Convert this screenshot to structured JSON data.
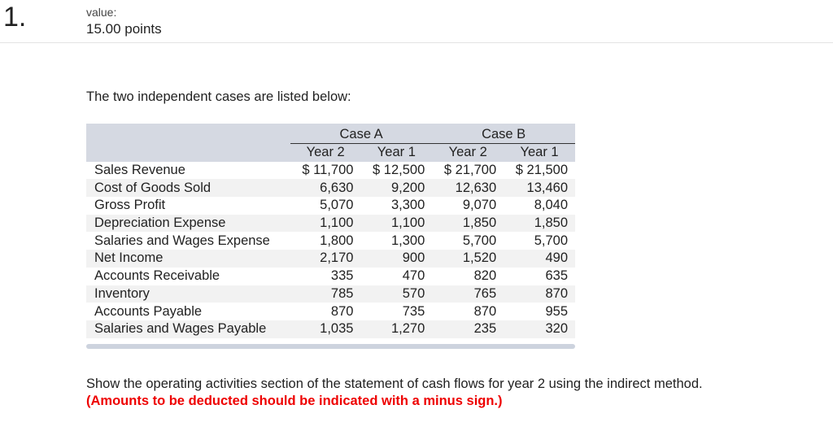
{
  "question": {
    "number": "1.",
    "value_label": "value:",
    "points": "15.00 points"
  },
  "intro": "The two independent cases are listed below:",
  "table": {
    "cases": [
      "Case A",
      "Case B"
    ],
    "years": [
      "Year 2",
      "Year 1",
      "Year 2",
      "Year 1"
    ],
    "rows": [
      {
        "label": "Sales Revenue",
        "values": [
          "$ 11,700",
          "$ 12,500",
          "$ 21,700",
          "$ 21,500"
        ]
      },
      {
        "label": "Cost of Goods Sold",
        "values": [
          "6,630",
          "9,200",
          "12,630",
          "13,460"
        ]
      },
      {
        "label": "Gross Profit",
        "values": [
          "5,070",
          "3,300",
          "9,070",
          "8,040"
        ]
      },
      {
        "label": "Depreciation Expense",
        "values": [
          "1,100",
          "1,100",
          "1,850",
          "1,850"
        ]
      },
      {
        "label": "Salaries and Wages Expense",
        "values": [
          "1,800",
          "1,300",
          "5,700",
          "5,700"
        ]
      },
      {
        "label": "Net Income",
        "values": [
          "2,170",
          "900",
          "1,520",
          "490"
        ]
      },
      {
        "label": "Accounts Receivable",
        "values": [
          "335",
          "470",
          "820",
          "635"
        ]
      },
      {
        "label": "Inventory",
        "values": [
          "785",
          "570",
          "765",
          "870"
        ]
      },
      {
        "label": "Accounts Payable",
        "values": [
          "870",
          "735",
          "870",
          "955"
        ]
      },
      {
        "label": "Salaries and Wages Payable",
        "values": [
          "1,035",
          "1,270",
          "235",
          "320"
        ]
      }
    ]
  },
  "instruction": "Show the operating activities section of the statement of cash flows for year 2 using the indirect method.",
  "note": "(Amounts to be deducted should be indicated with a minus sign.)"
}
